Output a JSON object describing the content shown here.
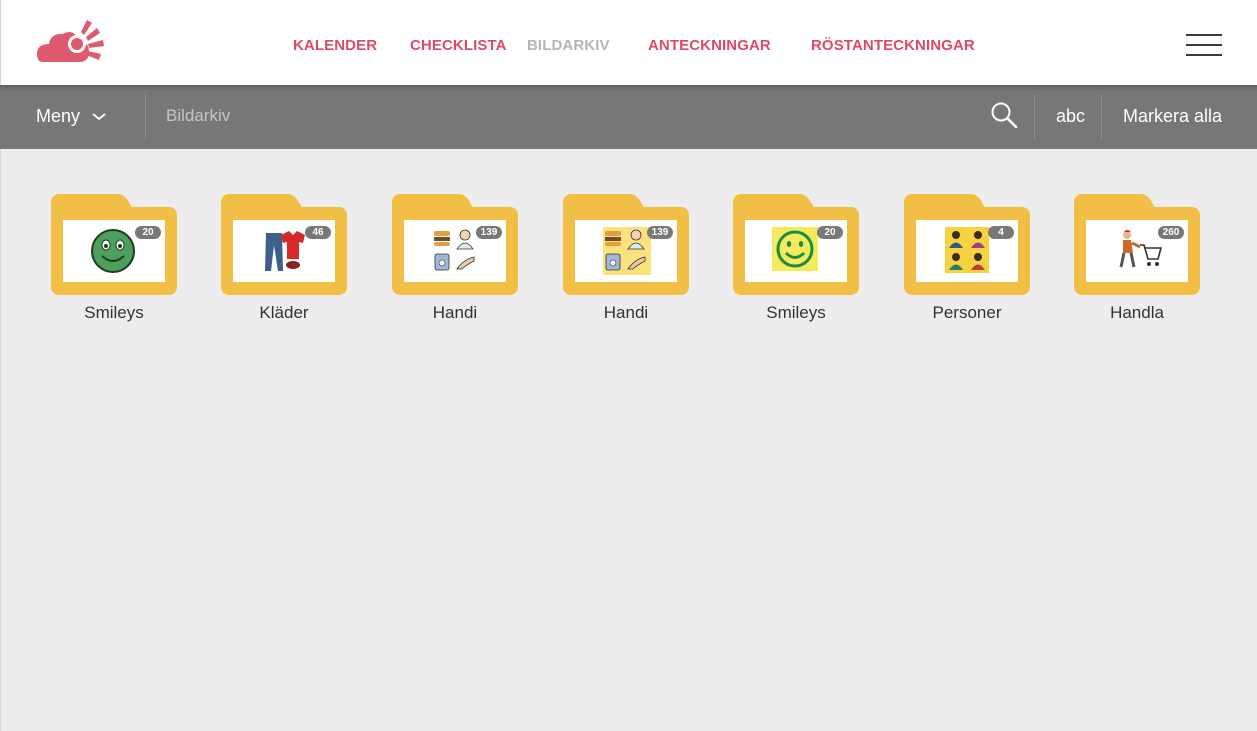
{
  "header": {
    "logo_icon": "cloud-sun-logo-icon",
    "nav": [
      {
        "label": "KALENDER",
        "active": false
      },
      {
        "label": "CHECKLISTA",
        "active": false
      },
      {
        "label": "BILDARKIV",
        "active": true
      },
      {
        "label": "ANTECKNINGAR",
        "active": false
      },
      {
        "label": "RÖSTANTECKNINGAR",
        "active": false
      }
    ],
    "menu_icon": "hamburger-icon"
  },
  "toolbar": {
    "menu_label": "Meny",
    "search_placeholder": "Bildarkiv",
    "search_value": "",
    "abc_label": "abc",
    "mark_all_label": "Markera alla"
  },
  "folders": [
    {
      "label": "Smileys",
      "count": "20",
      "icon": "green-smiley-face-icon"
    },
    {
      "label": "Kläder",
      "count": "46",
      "icon": "clothes-jeans-shirt-icon"
    },
    {
      "label": "Handi",
      "count": "139",
      "icon": "handi-collage-icon"
    },
    {
      "label": "Handi",
      "count": "139",
      "icon": "handi-collage-yellow-icon"
    },
    {
      "label": "Smileys",
      "count": "20",
      "icon": "smiley-yellow-icon"
    },
    {
      "label": "Personer",
      "count": "4",
      "icon": "people-group-icon"
    },
    {
      "label": "Handla",
      "count": "260",
      "icon": "person-shopping-cart-icon"
    }
  ],
  "colors": {
    "accent": "#dd4a67",
    "nav_active": "#b5b5b5",
    "toolbar_bg": "#777777",
    "folder": "#f1bf45",
    "badge": "#787878",
    "page_bg": "#ededed"
  }
}
